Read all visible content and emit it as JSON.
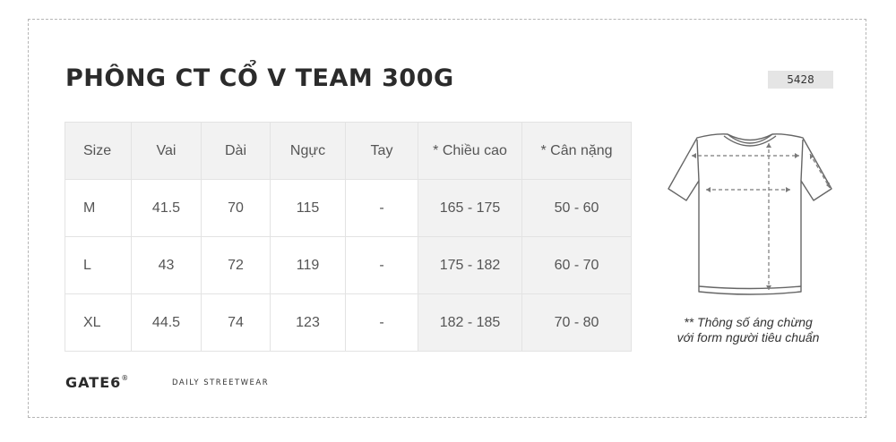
{
  "product": {
    "title": "PHÔNG CT CỔ V TEAM 300G",
    "code": "5428"
  },
  "table": {
    "headers": [
      "Size",
      "Vai",
      "Dài",
      "Ngực",
      "Tay",
      "* Chiều cao",
      "* Cân nặng"
    ],
    "rows": [
      [
        "M",
        "41.5",
        "70",
        "115",
        "-",
        "165 - 175",
        "50 - 60"
      ],
      [
        "L",
        "43",
        "72",
        "119",
        "-",
        "175 - 182",
        "60 - 70"
      ],
      [
        "XL",
        "44.5",
        "74",
        "123",
        "-",
        "182 - 185",
        "70 - 80"
      ]
    ]
  },
  "note": {
    "line1": "** Thông số áng chừng",
    "line2": "với form người tiêu chuẩn"
  },
  "brand": {
    "name": "GATE6",
    "mark": "®",
    "tagline": "DAILY STREETWEAR"
  },
  "illustration": {
    "icon": "tshirt-measurement-icon"
  }
}
